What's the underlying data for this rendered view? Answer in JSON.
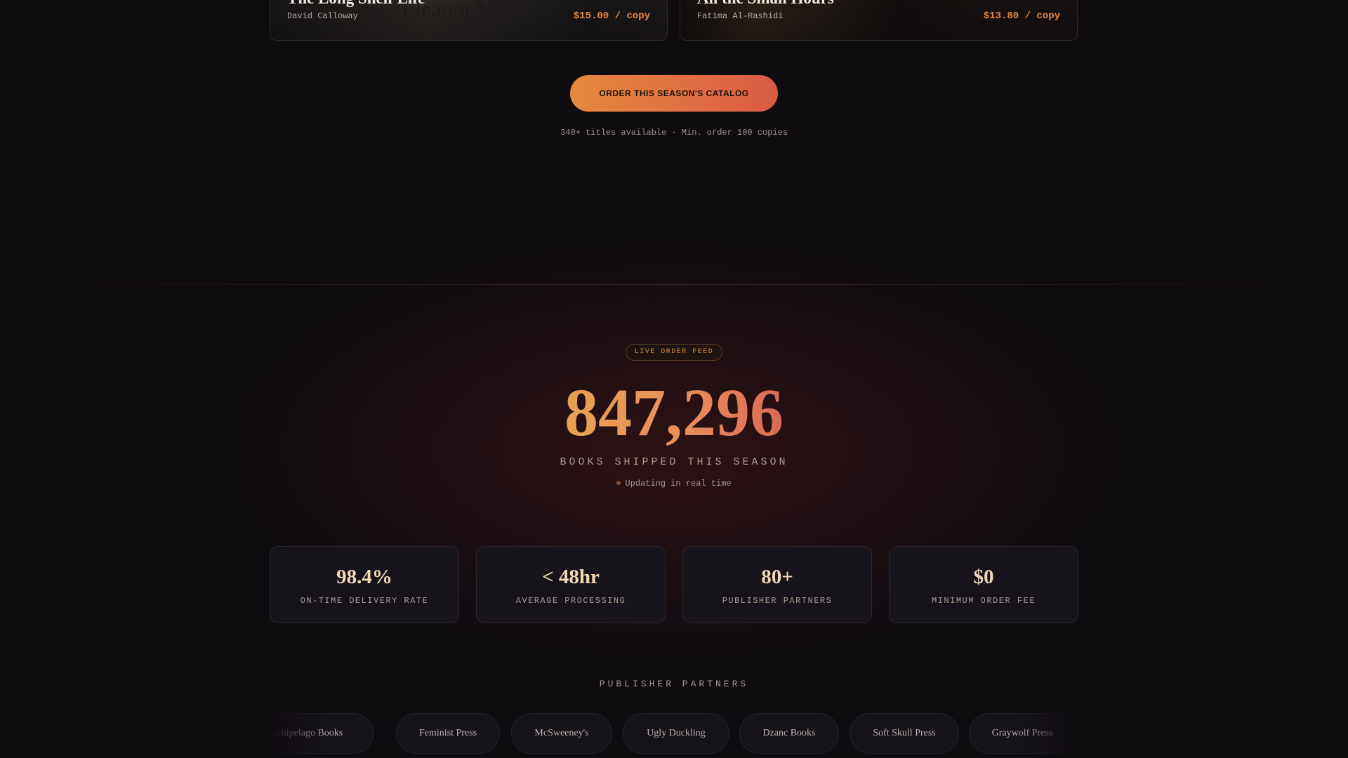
{
  "books": [
    {
      "title": "The Long Shelf Life",
      "author": "David Calloway",
      "price": "$15.00 / copy",
      "cover_text": "Eleanor Vance"
    },
    {
      "title": "All the Small Hours",
      "author": "Fatima Al-Rashidi",
      "price": "$13.80 / copy"
    }
  ],
  "cta": {
    "label": "ORDER THIS SEASON'S CATALOG",
    "subtext": "340+ titles available · Min. order 100 copies"
  },
  "live_feed": {
    "badge": "LIVE ORDER FEED",
    "count": "847,296",
    "label": "BOOKS SHIPPED THIS SEASON",
    "status": "Updating in real time"
  },
  "stats": [
    {
      "value": "98.4%",
      "label": "ON-TIME DELIVERY RATE"
    },
    {
      "value": "< 48hr",
      "label": "AVERAGE PROCESSING"
    },
    {
      "value": "80+",
      "label": "PUBLISHER PARTNERS"
    },
    {
      "value": "$0",
      "label": "MINIMUM ORDER FEE"
    }
  ],
  "partners": {
    "heading": "PUBLISHER PARTNERS",
    "items": [
      "Archipelago Books",
      "Feminist Press",
      "McSweeney's",
      "Ugly Duckling",
      "Dzanc Books",
      "Soft Skull Press",
      "Graywolf Press"
    ]
  },
  "colors": {
    "accent_orange": "#e58a3e",
    "accent_red": "#da5a44",
    "background": "#0f0c10"
  }
}
